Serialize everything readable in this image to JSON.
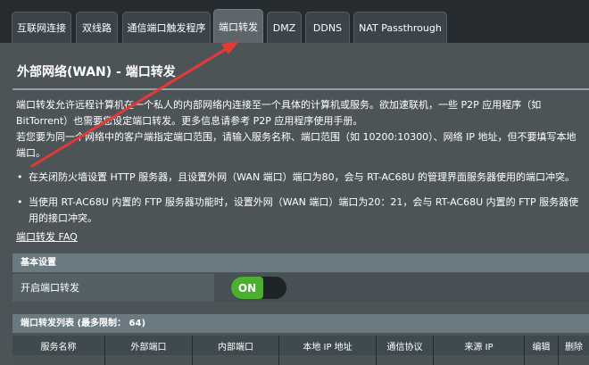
{
  "tabs": [
    {
      "label": "互联网连接",
      "active": false
    },
    {
      "label": "双线路",
      "active": false
    },
    {
      "label": "通信端口触发程序",
      "active": false
    },
    {
      "label": "端口转发",
      "active": true
    },
    {
      "label": "DMZ",
      "active": false
    },
    {
      "label": "DDNS",
      "active": false
    },
    {
      "label": "NAT Passthrough",
      "active": false
    }
  ],
  "page": {
    "title": "外部网络(WAN) - 端口转发",
    "description_line1": "端口转发允许远程计算机在一个私人的内部网络内连接至一个具体的计算机或服务。欲加速联机，一些 P2P 应用程序（如",
    "description_line2": "BitTorrent）也需要您设定端口转发。更多信息请参考 P2P 应用程序使用手册。",
    "description_line3": "若您要为同一个网络中的客户端指定端口范围，请输入服务名称、端口范围（如 10200:10300）、网络 IP 地址，但不要填写本地",
    "description_line4": "端口。",
    "bullet1": "在关闭防火墙设置 HTTP 服务器，且设置外网（WAN 端口）端口为80，会与 RT-AC68U 的管理界面服务器使用的端口冲突。",
    "bullet2_line1": "当使用 RT-AC68U 内置的 FTP 服务器功能时，设置外网（WAN 端口）端口为20：21，会与 RT-AC68U 内置的 FTP 服务器使",
    "bullet2_line2": "用的接口冲突。",
    "faq_link": "端口转发  FAQ"
  },
  "basic_settings": {
    "header": "基本设置",
    "enable_label": "开启端口转发",
    "toggle_label": "ON",
    "enabled": true
  },
  "forward_list": {
    "header": "端口转发列表 (最多限制： 64)",
    "columns": [
      "服务名称",
      "外部端口",
      "内部端口",
      "本地 IP 地址",
      "通信协议",
      "来源 IP",
      "编辑",
      "删除"
    ]
  },
  "colors": {
    "background": "#252b2e",
    "panel": "#4d5457",
    "toggle_on": "#4caf2f",
    "annotation_arrow": "#e53935"
  }
}
